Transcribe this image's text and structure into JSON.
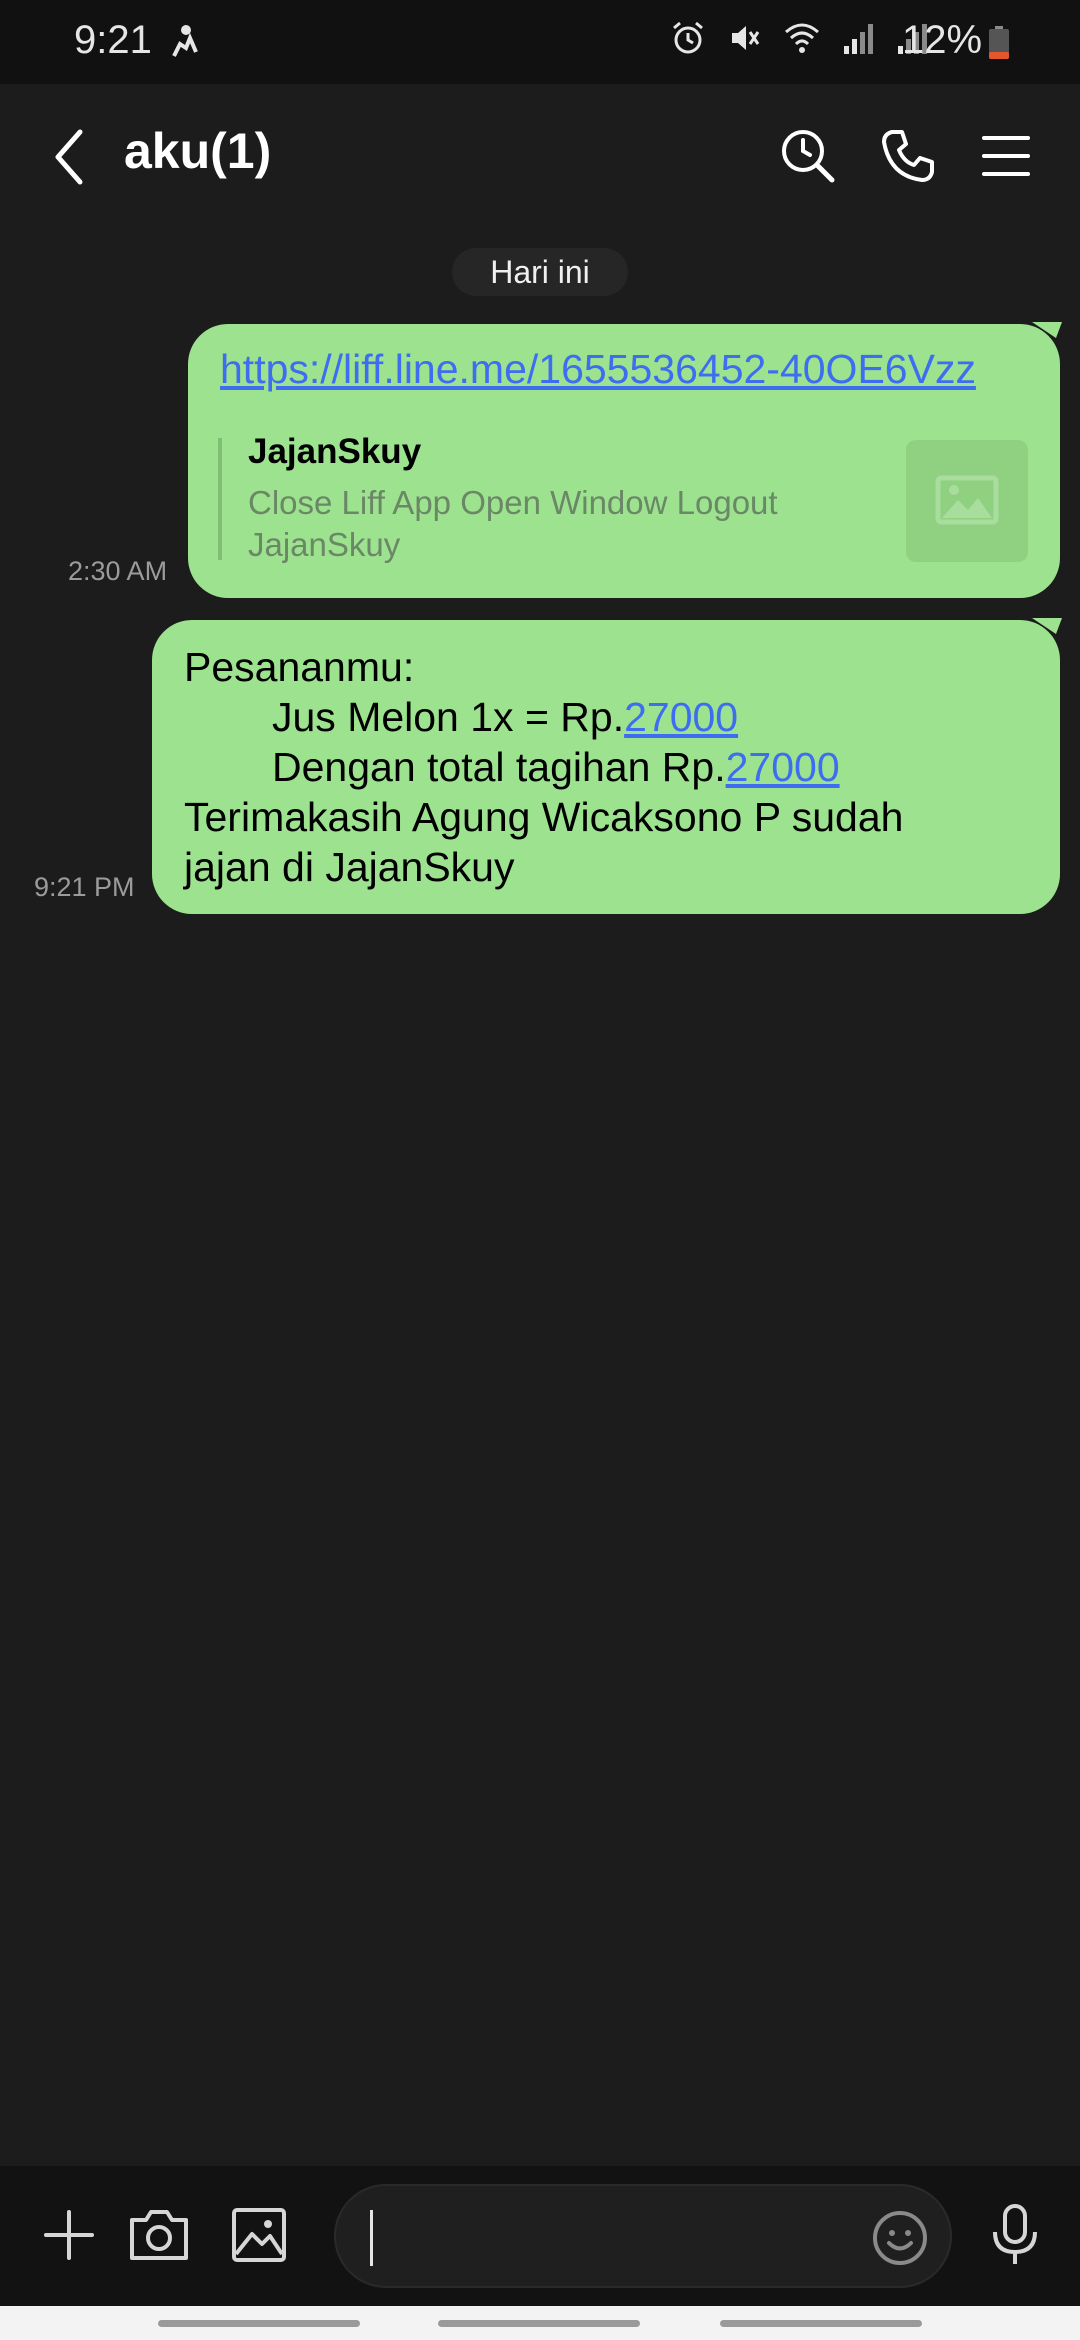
{
  "status_bar": {
    "time": "9:21",
    "battery": "12%",
    "icons": [
      "activity-icon",
      "alarm-icon",
      "mute-icon",
      "wifi-icon",
      "signal-icon",
      "signal-icon",
      "battery-icon"
    ]
  },
  "header": {
    "title": "aku(1)",
    "icons": [
      "back-arrow-icon",
      "search-icon",
      "phone-icon",
      "menu-icon"
    ]
  },
  "chat": {
    "date_label": "Hari ini",
    "messages": [
      {
        "time": "2:30 AM",
        "link": "https://liff.line.me/1655536452-40OE6Vzz",
        "preview_title": "JajanSkuy",
        "preview_desc": "Close Liff App Open Window Logout JajanSkuy",
        "preview_icon": "image-placeholder-icon"
      },
      {
        "time": "9:21 PM",
        "line1": "Pesananmu:",
        "line2_prefix": "Jus Melon 1x = Rp.",
        "line2_amount": "27000",
        "line3_prefix": "Dengan total tagihan Rp.",
        "line3_amount": "27000",
        "line4": "Terimakasih Agung Wicaksono P sudah",
        "line5": "jajan di JajanSkuy"
      }
    ]
  },
  "input_bar": {
    "message_value": "",
    "icons": [
      "plus-icon",
      "camera-icon",
      "gallery-icon",
      "emoji-icon",
      "microphone-icon"
    ]
  },
  "colors": {
    "background": "#1c1c1c",
    "bubble": "#9de38f",
    "link": "#3f6df1",
    "timestamp": "#9b9b9b"
  }
}
